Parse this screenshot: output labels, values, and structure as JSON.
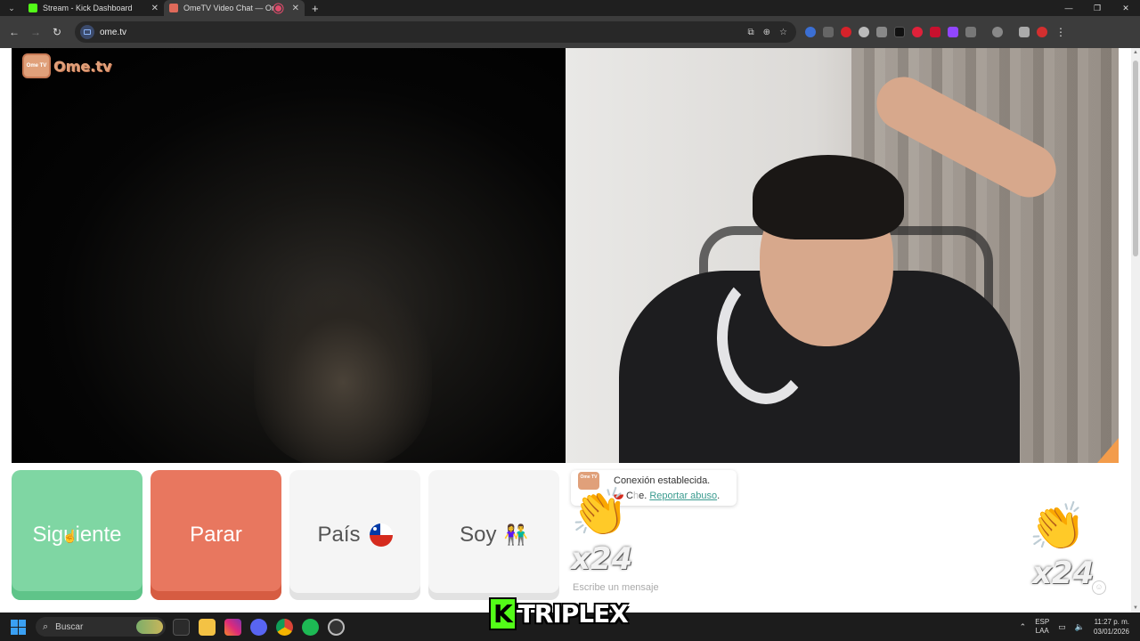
{
  "browser": {
    "tabs": [
      {
        "title": "Stream - Kick Dashboard",
        "favicon_color": "#53fc18",
        "active": false
      },
      {
        "title": "OmeTV Video Chat — Ome",
        "favicon_color": "#e06a5a",
        "active": true
      }
    ],
    "new_tab_icon": "plus-icon",
    "address": "ome.tv"
  },
  "page": {
    "logo_text": "Ome.tv",
    "logo_badge": "Ome TV",
    "buttons": {
      "next": "Siguiente",
      "stop": "Parar",
      "country": "País",
      "gender": "Soy"
    },
    "chat": {
      "status_line": "Conexión establecida.",
      "country_name_partial": "C",
      "country_name_suffix": "e.",
      "report_link": "Reportar abuso",
      "report_suffix": ".",
      "input_placeholder": "Escribe un mensaje",
      "clap_count_left": "x24",
      "clap_count_right": "x24"
    }
  },
  "overlay": {
    "brand_letter": "K",
    "brand_name": "TRIPLEX"
  },
  "taskbar": {
    "search_placeholder": "Buscar",
    "lang_top": "ESP",
    "lang_bottom": "LAA",
    "time": "11:27 p. m.",
    "date": "03/01/2026"
  },
  "colors": {
    "next_button": "#7fd6a3",
    "stop_button": "#e8775f",
    "report_link": "#3a9b8f",
    "kick_green": "#53fc18"
  }
}
